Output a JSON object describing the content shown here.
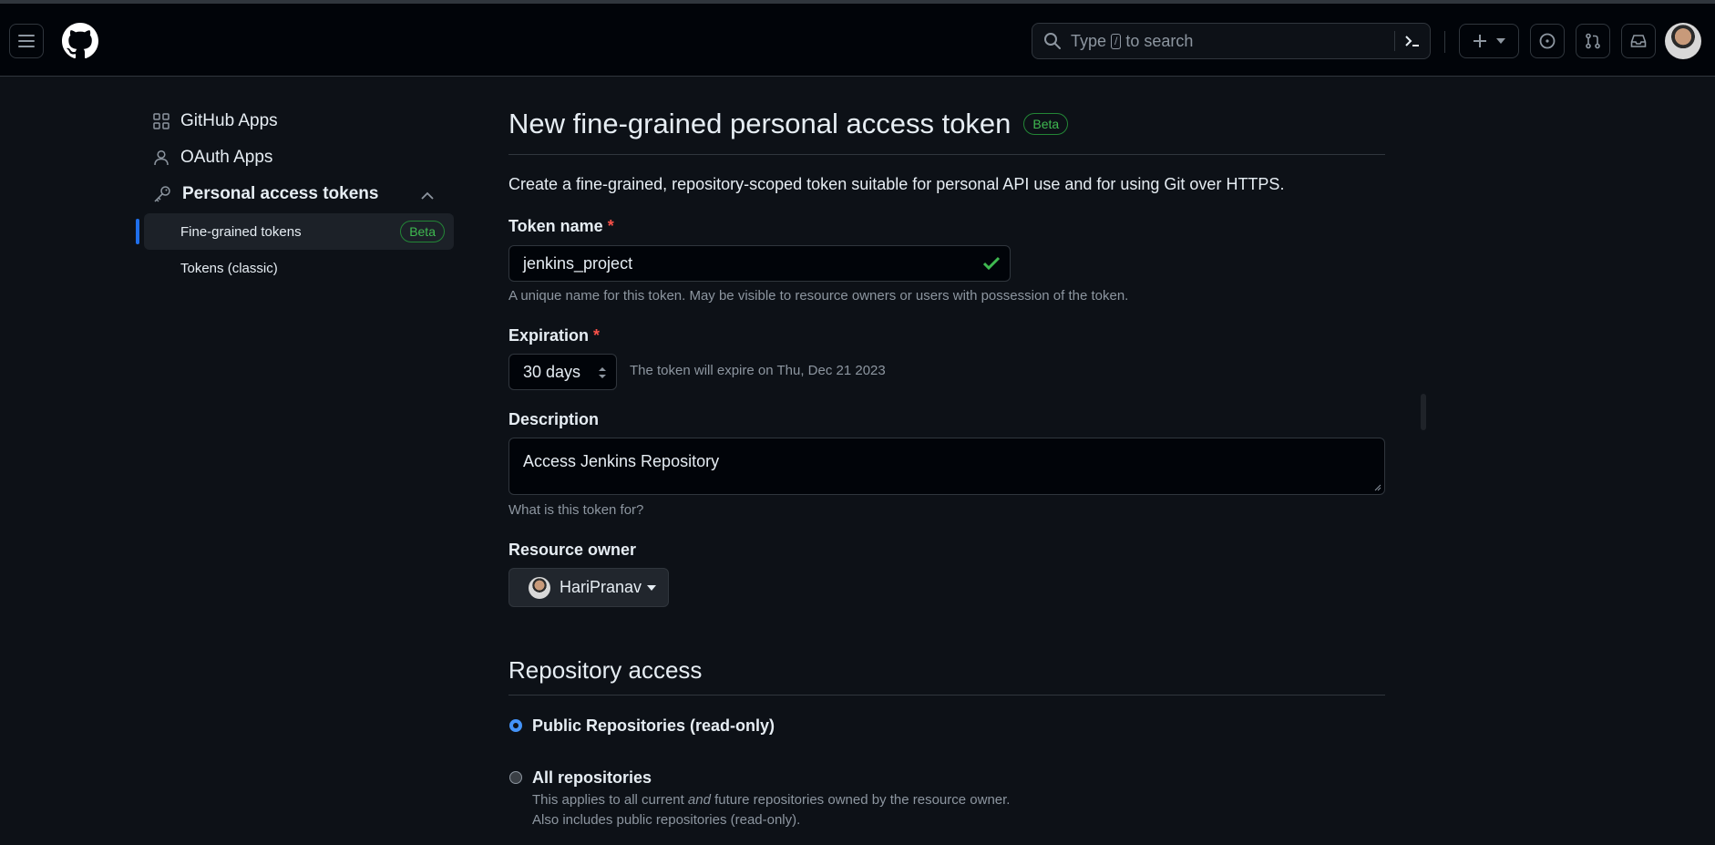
{
  "header": {
    "search_prefix": "Type",
    "search_key": "/",
    "search_suffix": "to search"
  },
  "sidebar": {
    "items": [
      {
        "label": "GitHub Apps",
        "icon": "apps-grid-icon"
      },
      {
        "label": "OAuth Apps",
        "icon": "person-icon"
      },
      {
        "label": "Personal access tokens",
        "icon": "key-icon"
      }
    ],
    "subitems": [
      {
        "label": "Fine-grained tokens",
        "badge": "Beta",
        "selected": true
      },
      {
        "label": "Tokens (classic)"
      }
    ]
  },
  "page": {
    "title": "New fine-grained personal access token",
    "title_badge": "Beta",
    "intro": "Create a fine-grained, repository-scoped token suitable for personal API use and for using Git over HTTPS."
  },
  "form": {
    "token_name": {
      "label": "Token name",
      "required": "*",
      "value": "jenkins_project",
      "hint": "A unique name for this token. May be visible to resource owners or users with possession of the token."
    },
    "expiration": {
      "label": "Expiration",
      "required": "*",
      "value": "30 days",
      "hint": "The token will expire on Thu, Dec 21 2023"
    },
    "description": {
      "label": "Description",
      "value": "Access Jenkins Repository",
      "hint": "What is this token for?"
    },
    "resource_owner": {
      "label": "Resource owner",
      "value": "HariPranav"
    }
  },
  "repository_access": {
    "title": "Repository access",
    "options": [
      {
        "label": "Public Repositories (read-only)",
        "checked": true
      },
      {
        "label": "All repositories",
        "checked": false,
        "desc_part1": "This applies to all current",
        "desc_em": "and",
        "desc_part2": "future repositories owned by the resource owner.",
        "desc_line2": "Also includes public repositories (read-only)."
      }
    ]
  },
  "colors": {
    "accent_blue": "#1f6feb",
    "success_green": "#3fb950",
    "required_red": "#f85149"
  }
}
